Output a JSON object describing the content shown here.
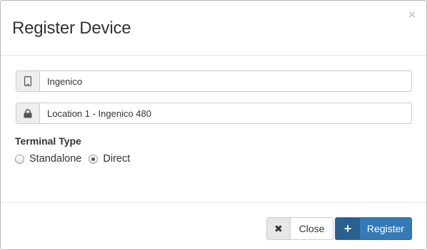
{
  "dialog": {
    "title": "Register Device",
    "close_glyph": "×"
  },
  "device_name": {
    "value": "Ingenico",
    "icon": "mobile-phone-icon"
  },
  "location": {
    "value": "Location 1 - Ingenico 480",
    "icon": "lock-icon"
  },
  "terminal_type": {
    "label": "Terminal Type",
    "options": [
      {
        "label": "Standalone",
        "selected": false
      },
      {
        "label": "Direct",
        "selected": true
      }
    ]
  },
  "footer": {
    "close_label": "Close",
    "close_icon_glyph": "✖",
    "register_label": "Register",
    "register_icon_glyph": "+"
  },
  "colors": {
    "primary": "#337ab7",
    "primary_dark": "#286090"
  }
}
